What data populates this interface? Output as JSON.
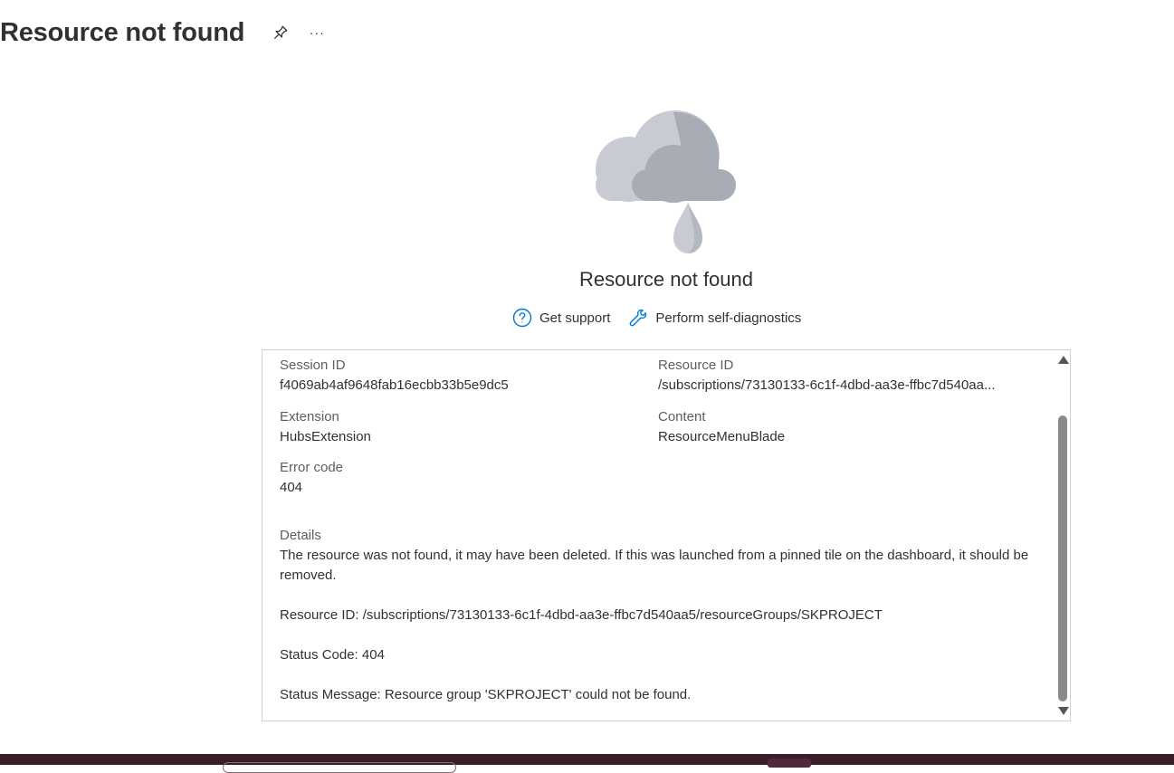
{
  "header": {
    "title": "Resource not found",
    "pin_icon": "pin-icon",
    "more_label": "···"
  },
  "empty_state": {
    "illustration": "cloud-rain-icon",
    "title": "Resource not found",
    "actions": [
      {
        "icon": "question-circle-icon",
        "label": "Get support"
      },
      {
        "icon": "wrench-icon",
        "label": "Perform self-diagnostics"
      }
    ]
  },
  "details": {
    "fields": {
      "session_id": {
        "label": "Session ID",
        "value": "f4069ab4af9648fab16ecbb33b5e9dc5"
      },
      "resource_id": {
        "label": "Resource ID",
        "value": "/subscriptions/73130133-6c1f-4dbd-aa3e-ffbc7d540aa..."
      },
      "extension": {
        "label": "Extension",
        "value": "HubsExtension"
      },
      "content": {
        "label": "Content",
        "value": "ResourceMenuBlade"
      },
      "error_code": {
        "label": "Error code",
        "value": "404"
      }
    },
    "details_label": "Details",
    "details_paragraphs": [
      "The resource was not found, it may have been deleted. If this was launched from a pinned tile on the dashboard, it should be removed.",
      "Resource ID: /subscriptions/73130133-6c1f-4dbd-aa3e-ffbc7d540aa5/resourceGroups/SKPROJECT",
      "Status Code: 404",
      "Status Message: Resource group 'SKPROJECT' could not be found."
    ]
  },
  "colors": {
    "accent": "#0078d4",
    "taskbar": "#3b1d2a",
    "cloud_light": "#c8ccd2",
    "cloud_dark": "#a8adb5"
  }
}
